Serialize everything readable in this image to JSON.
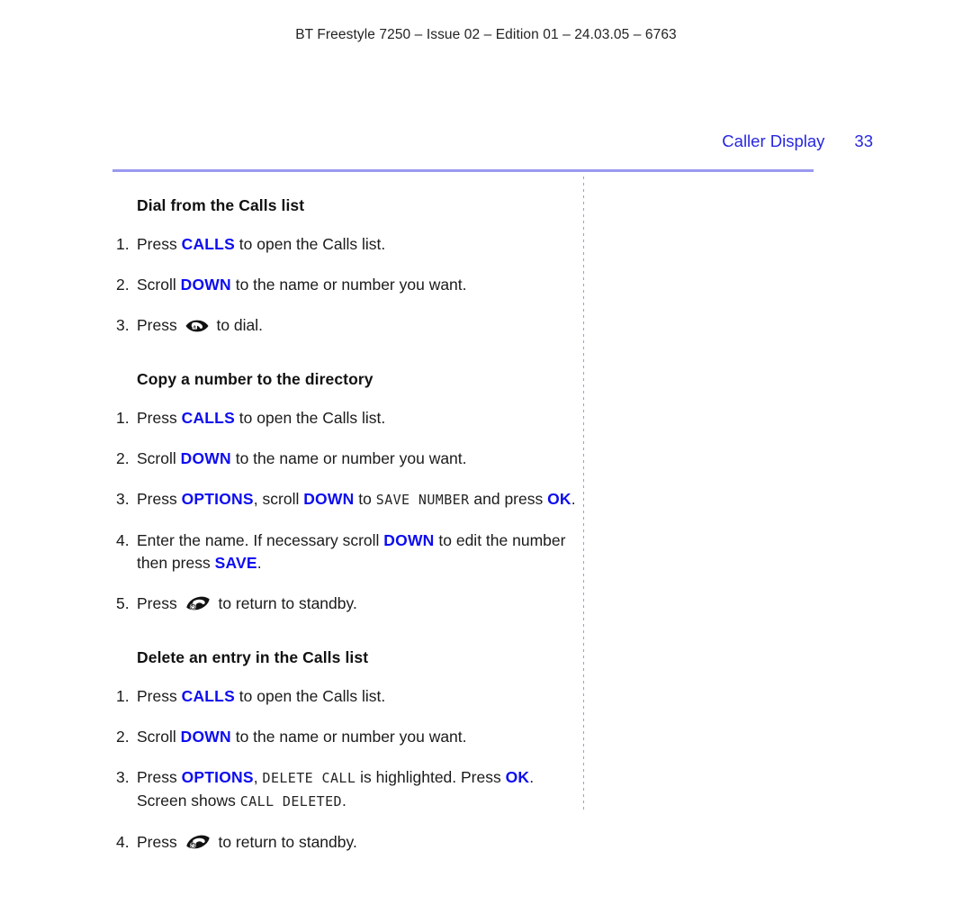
{
  "doc_header": "BT Freestyle 7250 – Issue 02 – Edition 01 – 24.03.05 – 6763",
  "page_header": {
    "section_name": "Caller Display",
    "page_number": "33",
    "color": "#2727e0"
  },
  "rule_color": "#9a9af0",
  "keyword_color": "#0d0df0",
  "sections": [
    {
      "title": "Dial from the Calls list",
      "steps": [
        {
          "num": "1.",
          "parts": [
            {
              "t": "Press ",
              "k": "plain"
            },
            {
              "t": "CALLS",
              "k": "keyword"
            },
            {
              "t": " to open the Calls list.",
              "k": "plain"
            }
          ]
        },
        {
          "num": "2.",
          "parts": [
            {
              "t": "Scroll ",
              "k": "plain"
            },
            {
              "t": "DOWN",
              "k": "keyword"
            },
            {
              "t": " to the name or number you want.",
              "k": "plain"
            }
          ]
        },
        {
          "num": "3.",
          "parts": [
            {
              "t": "Press ",
              "k": "plain"
            },
            {
              "t": "",
              "k": "icon",
              "icon": "talk-key-icon"
            },
            {
              "t": " to dial.",
              "k": "plain"
            }
          ]
        }
      ]
    },
    {
      "title": "Copy a number to the directory",
      "steps": [
        {
          "num": "1.",
          "parts": [
            {
              "t": "Press ",
              "k": "plain"
            },
            {
              "t": "CALLS",
              "k": "keyword"
            },
            {
              "t": " to open the Calls list.",
              "k": "plain"
            }
          ]
        },
        {
          "num": "2.",
          "parts": [
            {
              "t": "Scroll ",
              "k": "plain"
            },
            {
              "t": "DOWN",
              "k": "keyword"
            },
            {
              "t": " to the name or number you want.",
              "k": "plain"
            }
          ]
        },
        {
          "num": "3.",
          "parts": [
            {
              "t": "Press ",
              "k": "plain"
            },
            {
              "t": "OPTIONS",
              "k": "keyword"
            },
            {
              "t": ", scroll ",
              "k": "plain"
            },
            {
              "t": "DOWN",
              "k": "keyword"
            },
            {
              "t": " to ",
              "k": "plain"
            },
            {
              "t": "SAVE NUMBER",
              "k": "lcd"
            },
            {
              "t": " and press ",
              "k": "plain"
            },
            {
              "t": "OK",
              "k": "keyword"
            },
            {
              "t": ".",
              "k": "plain"
            }
          ]
        },
        {
          "num": "4.",
          "parts": [
            {
              "t": "Enter the name. If necessary scroll ",
              "k": "plain"
            },
            {
              "t": "DOWN",
              "k": "keyword"
            },
            {
              "t": " to edit the number then press ",
              "k": "plain"
            },
            {
              "t": "SAVE",
              "k": "keyword"
            },
            {
              "t": ".",
              "k": "plain"
            }
          ]
        },
        {
          "num": "5.",
          "parts": [
            {
              "t": "Press ",
              "k": "plain"
            },
            {
              "t": "",
              "k": "icon",
              "icon": "standby-key-icon"
            },
            {
              "t": " to return to standby.",
              "k": "plain"
            }
          ]
        }
      ]
    },
    {
      "title": "Delete an entry in the Calls list",
      "steps": [
        {
          "num": "1.",
          "parts": [
            {
              "t": "Press ",
              "k": "plain"
            },
            {
              "t": "CALLS",
              "k": "keyword"
            },
            {
              "t": " to open the Calls list.",
              "k": "plain"
            }
          ]
        },
        {
          "num": "2.",
          "parts": [
            {
              "t": "Scroll ",
              "k": "plain"
            },
            {
              "t": "DOWN",
              "k": "keyword"
            },
            {
              "t": " to the name or number you want.",
              "k": "plain"
            }
          ]
        },
        {
          "num": "3.",
          "parts": [
            {
              "t": "Press ",
              "k": "plain"
            },
            {
              "t": "OPTIONS",
              "k": "keyword"
            },
            {
              "t": ", ",
              "k": "plain"
            },
            {
              "t": "DELETE CALL",
              "k": "lcd"
            },
            {
              "t": " is highlighted. Press ",
              "k": "plain"
            },
            {
              "t": "OK",
              "k": "keyword"
            },
            {
              "t": ". Screen shows ",
              "k": "plain"
            },
            {
              "t": "CALL DELETED",
              "k": "lcd"
            },
            {
              "t": ".",
              "k": "plain"
            }
          ]
        },
        {
          "num": "4.",
          "parts": [
            {
              "t": "Press ",
              "k": "plain"
            },
            {
              "t": "",
              "k": "icon",
              "icon": "standby-key-icon"
            },
            {
              "t": " to return to standby.",
              "k": "plain"
            }
          ]
        }
      ]
    }
  ]
}
